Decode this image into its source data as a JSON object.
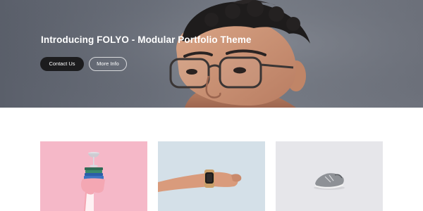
{
  "hero": {
    "title": "Introducing FOLYO - Modular Portfolio Theme",
    "primary_button": "Contact Us",
    "secondary_button": "More Info"
  },
  "portfolio": {
    "items": [
      {
        "image": "pink-card-hand-holding-glass-on-books",
        "bg_color": "#f5b8c8"
      },
      {
        "image": "arm-with-smartwatch",
        "bg_color": "#d4e0e8"
      },
      {
        "image": "grey-sneaker",
        "bg_color": "#e6e6ea"
      }
    ]
  },
  "colors": {
    "primary_button_bg": "#1c1c1e",
    "text_light": "#ffffff"
  }
}
